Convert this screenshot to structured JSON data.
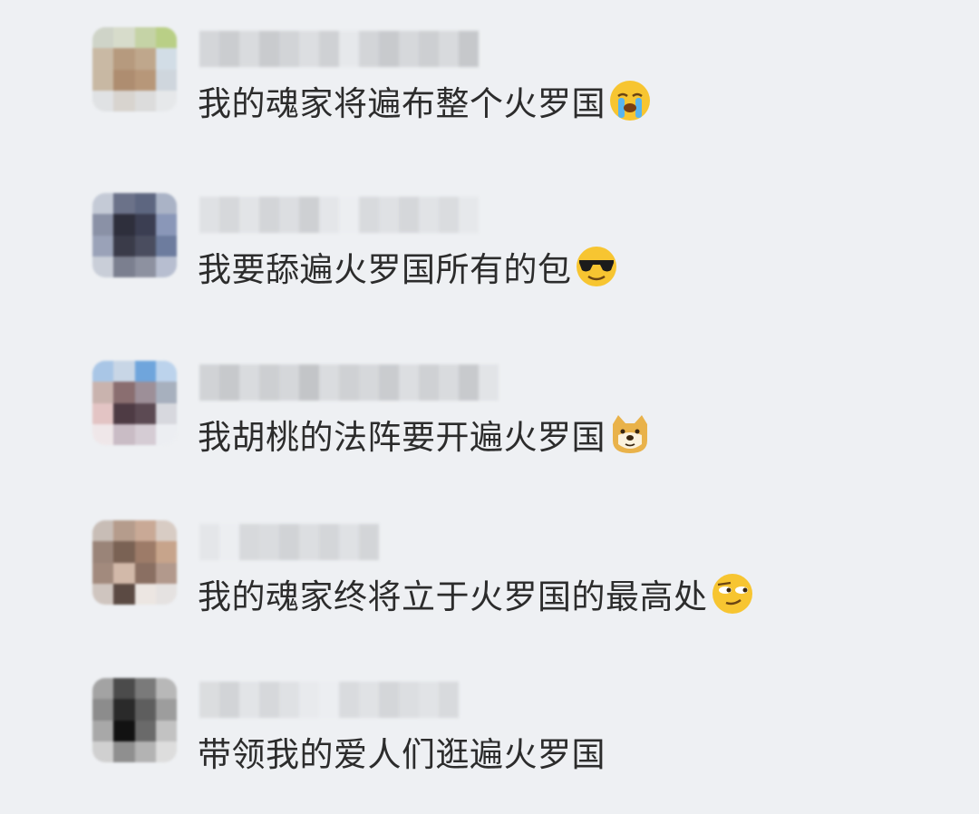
{
  "comments": [
    {
      "text": "我的魂家将遍布整个火罗国",
      "emoji": "loudly-crying-face-icon"
    },
    {
      "text": "我要舔遍火罗国所有的包",
      "emoji": "sunglasses-face-icon"
    },
    {
      "text": "我胡桃的法阵要开遍火罗国",
      "emoji": "doge-face-icon"
    },
    {
      "text": "我的魂家终将立于火罗国的最高处",
      "emoji": "smirking-face-icon"
    },
    {
      "text": "带领我的爱人们逛遍火罗国",
      "emoji": ""
    }
  ],
  "colors": {
    "background": "#eef0f3",
    "text": "#2c2c2c"
  }
}
